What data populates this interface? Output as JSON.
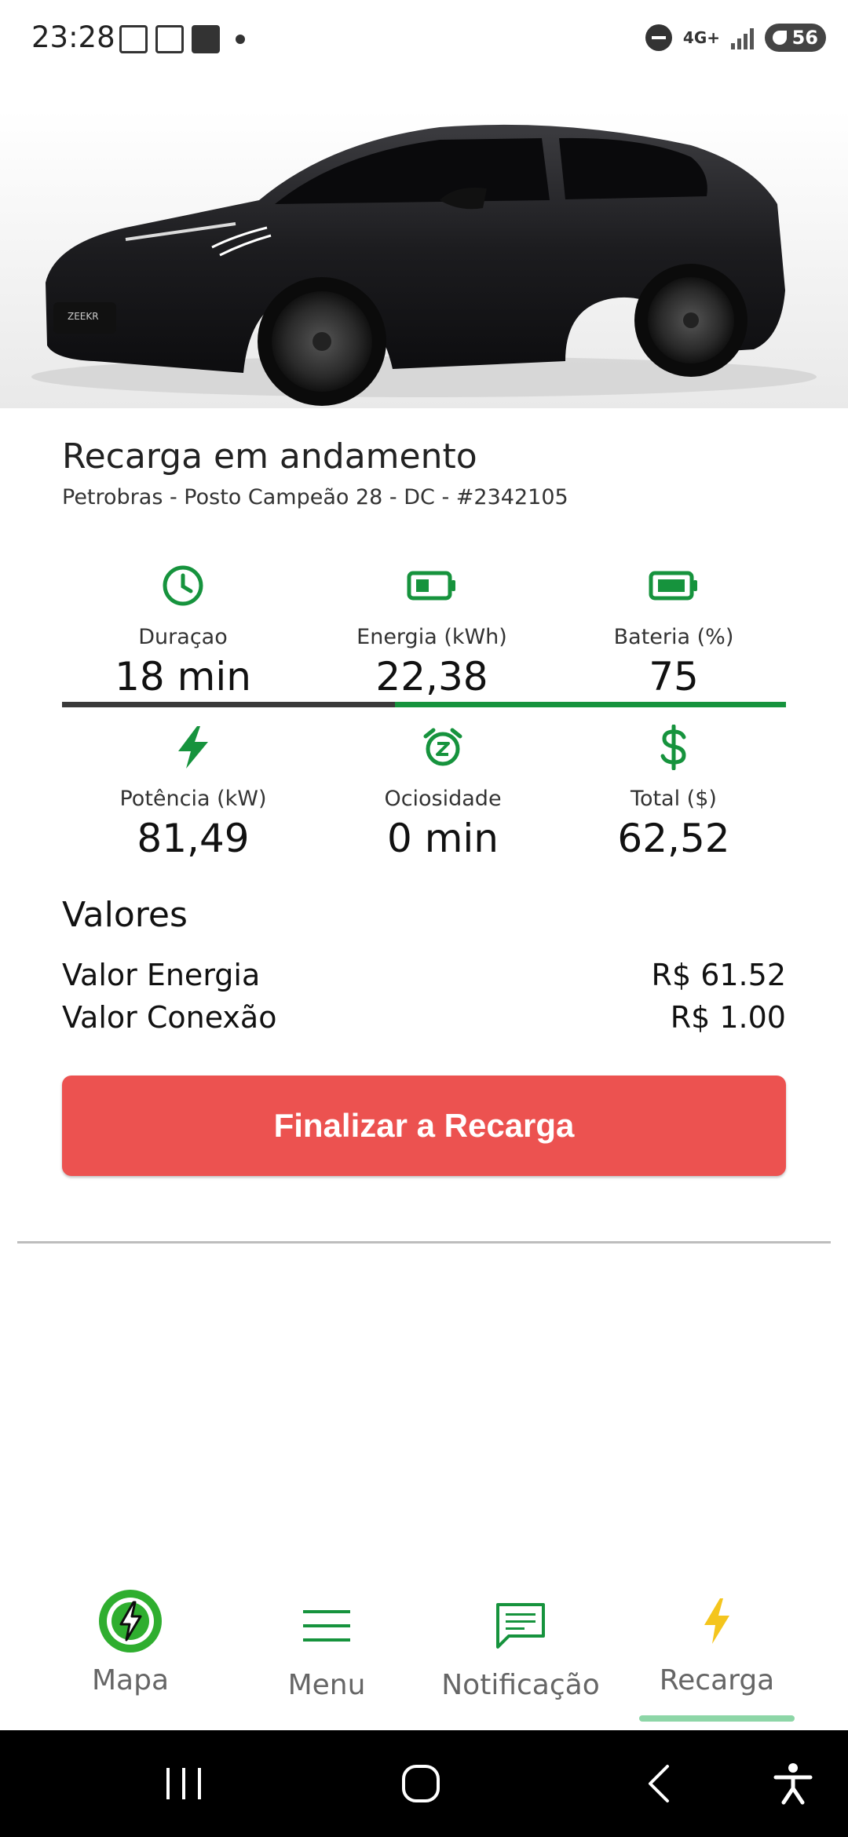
{
  "status_bar": {
    "time": "23:28",
    "network": "4G+",
    "battery": "56"
  },
  "session": {
    "title": "Recarga em andamento",
    "subtitle": "Petrobras - Posto Campeão 28 - DC - #2342105"
  },
  "stats": [
    {
      "label": "Duraçao",
      "value": "18 min",
      "icon": "clock-icon"
    },
    {
      "label": "Energia (kWh)",
      "value": "22,38",
      "icon": "battery-low-icon"
    },
    {
      "label": "Bateria (%)",
      "value": "75",
      "icon": "battery-full-icon"
    },
    {
      "label": "Potência (kW)",
      "value": "81,49",
      "icon": "bolt-icon"
    },
    {
      "label": "Ociosidade",
      "value": "0 min",
      "icon": "alarm-snooze-icon"
    },
    {
      "label": "Total ($)",
      "value": "62,52",
      "icon": "dollar-icon"
    }
  ],
  "progress": {
    "fraction": 0.46
  },
  "valores": {
    "title": "Valores",
    "rows": [
      {
        "label": "Valor Energia",
        "value": "R$ 61.52"
      },
      {
        "label": "Valor Conexão",
        "value": "R$ 1.00"
      }
    ]
  },
  "actions": {
    "finish_label": "Finalizar a Recarga"
  },
  "bottom_nav": {
    "items": [
      {
        "label": "Mapa",
        "icon": "charging-bolt-logo-icon"
      },
      {
        "label": "Menu",
        "icon": "menu-icon"
      },
      {
        "label": "Notificação",
        "icon": "message-icon"
      },
      {
        "label": "Recarga",
        "icon": "bolt-icon",
        "active": true
      }
    ]
  },
  "colors": {
    "accent_green": "#16933d",
    "button_red": "#ec5250",
    "recarga_yellow": "#f4c51d",
    "active_indicator": "#8dd6a7"
  }
}
